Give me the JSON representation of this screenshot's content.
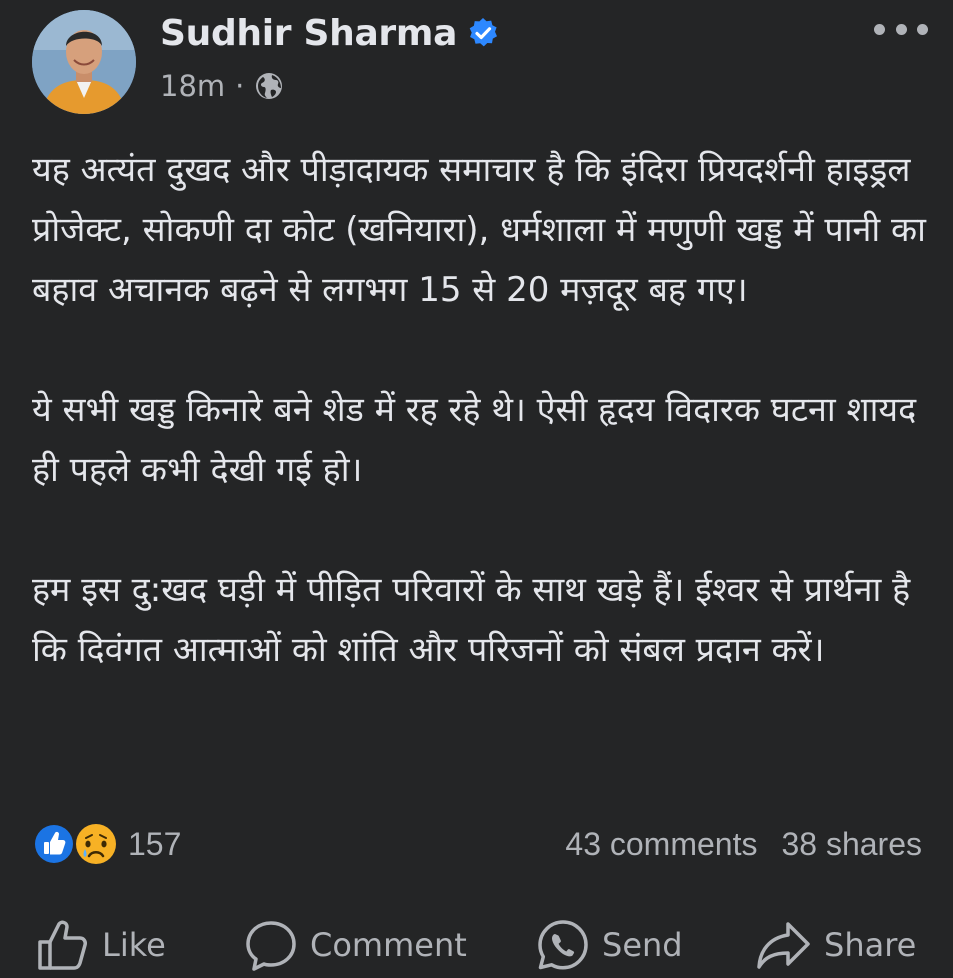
{
  "post": {
    "author": {
      "name": "Sudhir Sharma",
      "verified": true
    },
    "time": "18m",
    "separator": "·",
    "audience_icon": "globe-icon",
    "paragraphs": [
      "यह अत्यंत दुखद और पीड़ादायक समाचार है कि इंदिरा प्रियदर्शनी हाइड्रल प्रोजेक्ट, सोकणी दा कोट (खनियारा), धर्मशाला में मणुणी खड्ड में पानी का बहाव अचानक बढ़ने से लगभग 15 से 20 मज़दूर बह गए।",
      "ये सभी खड्ड किनारे बने शेड में रह रहे थे। ऐसी हृदय विदारक घटना शायद ही पहले कभी देखी गई हो।",
      "हम इस दु:खद घड़ी में पीड़ित परिवारों के साथ खड़े हैं। ईश्वर से प्रार्थना है कि दिवंगत आत्माओं को शांति और परिजनों को संबल प्रदान करें।"
    ],
    "reactions": {
      "types": [
        "like",
        "sad"
      ],
      "count": "157"
    },
    "comments": "43 comments",
    "shares": "38 shares"
  },
  "actions": {
    "like": "Like",
    "comment": "Comment",
    "send": "Send",
    "share": "Share"
  },
  "colors": {
    "background": "#242526",
    "primary_text": "#e4e6eb",
    "secondary_text": "#b0b3b8",
    "verified_blue": "#2d88ff",
    "like_blue": "#1b74e4",
    "sad_yellow": "#f7b125"
  }
}
